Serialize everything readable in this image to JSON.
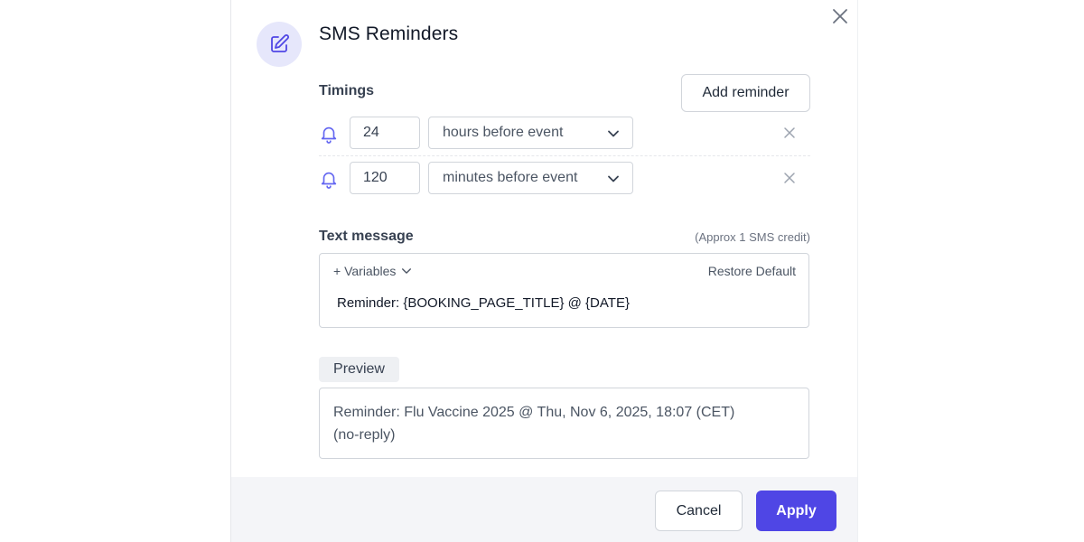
{
  "dialog": {
    "title": "SMS Reminders",
    "icon": "edit-icon",
    "close_icon": "close-icon"
  },
  "timings": {
    "label": "Timings",
    "add_label": "Add reminder",
    "reminders": [
      {
        "value": "24",
        "unit": "hours before event"
      },
      {
        "value": "120",
        "unit": "minutes before event"
      }
    ]
  },
  "message": {
    "label": "Text message",
    "credit_note": "(Approx 1 SMS credit)",
    "variables_label": "+ Variables",
    "restore_label": "Restore Default",
    "text": "Reminder: {BOOKING_PAGE_TITLE} @ {DATE}"
  },
  "preview": {
    "label": "Preview",
    "line1": "Reminder: Flu Vaccine 2025 @ Thu, Nov 6, 2025, 18:07 (CET)",
    "line2": "(no-reply)"
  },
  "footer": {
    "cancel_label": "Cancel",
    "apply_label": "Apply"
  },
  "colors": {
    "accent": "#4f46e5",
    "icon_bg": "#e6e7fb",
    "bell": "#6366f1"
  }
}
